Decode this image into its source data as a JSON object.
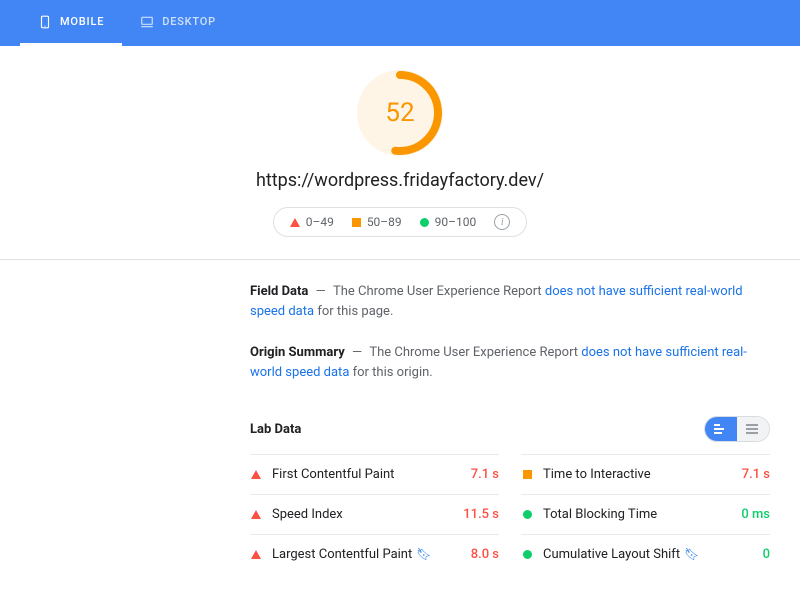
{
  "tabs": {
    "mobile": "MOBILE",
    "desktop": "DESKTOP"
  },
  "score": {
    "value": "52",
    "url": "https://wordpress.fridayfactory.dev/"
  },
  "legend": {
    "r1": "0–49",
    "r2": "50–89",
    "r3": "90–100"
  },
  "field_data": {
    "label": "Field Data",
    "pre": "The Chrome User Experience Report ",
    "link": "does not have sufficient real-world speed data",
    "post": " for this page."
  },
  "origin_summary": {
    "label": "Origin Summary",
    "pre": "The Chrome User Experience Report ",
    "link": "does not have sufficient real-world speed data",
    "post": " for this origin."
  },
  "lab": {
    "title": "Lab Data"
  },
  "metrics": {
    "fcp": {
      "name": "First Contentful Paint",
      "value": "7.1 s"
    },
    "si": {
      "name": "Speed Index",
      "value": "11.5 s"
    },
    "lcp": {
      "name": "Largest Contentful Paint",
      "value": "8.0 s"
    },
    "tti": {
      "name": "Time to Interactive",
      "value": "7.1 s"
    },
    "tbt": {
      "name": "Total Blocking Time",
      "value": "0 ms"
    },
    "cls": {
      "name": "Cumulative Layout Shift",
      "value": "0"
    }
  }
}
